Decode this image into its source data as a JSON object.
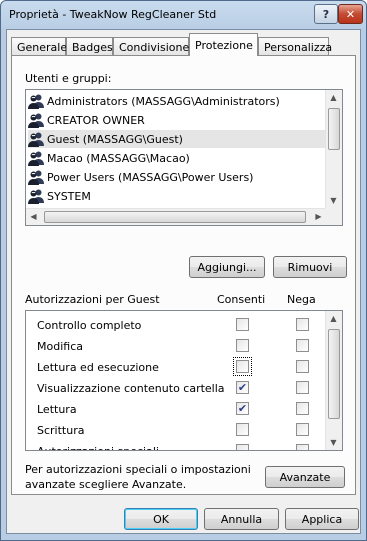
{
  "window": {
    "title": "Proprietà - TweakNow RegCleaner Std",
    "help_glyph": "?",
    "close_glyph": "✕"
  },
  "tabs": [
    {
      "label": "Generale",
      "active": false
    },
    {
      "label": "Badges",
      "active": false
    },
    {
      "label": "Condivisione",
      "active": false
    },
    {
      "label": "Protezione",
      "active": true
    },
    {
      "label": "Personalizza",
      "active": false
    }
  ],
  "users_label": "Utenti e gruppi:",
  "users": [
    {
      "name": "Administrators (MASSAGG\\Administrators)",
      "selected": false
    },
    {
      "name": "CREATOR OWNER",
      "selected": false
    },
    {
      "name": "Guest (MASSAGG\\Guest)",
      "selected": true
    },
    {
      "name": "Macao (MASSAGG\\Macao)",
      "selected": false
    },
    {
      "name": "Power Users (MASSAGG\\Power Users)",
      "selected": false
    },
    {
      "name": "SYSTEM",
      "selected": false
    }
  ],
  "buttons": {
    "add": "Aggiungi...",
    "remove": "Rimuovi",
    "advanced": "Avanzate",
    "ok": "OK",
    "cancel": "Annulla",
    "apply": "Applica"
  },
  "permissions": {
    "title": "Autorizzazioni per Guest",
    "allow_header": "Consenti",
    "deny_header": "Nega",
    "rows": [
      {
        "name": "Controllo completo",
        "allow": false,
        "deny": false
      },
      {
        "name": "Modifica",
        "allow": false,
        "deny": false
      },
      {
        "name": "Lettura ed esecuzione",
        "allow": false,
        "deny": false,
        "focused": true
      },
      {
        "name": "Visualizzazione contenuto cartella",
        "allow": true,
        "deny": false
      },
      {
        "name": "Lettura",
        "allow": true,
        "deny": false
      },
      {
        "name": "Scrittura",
        "allow": false,
        "deny": false
      },
      {
        "name": "Autorizzazioni speciali",
        "allow": false,
        "deny": false
      }
    ]
  },
  "advanced_note": "Per autorizzazioni speciali o impostazioni avanzate scegliere Avanzate."
}
